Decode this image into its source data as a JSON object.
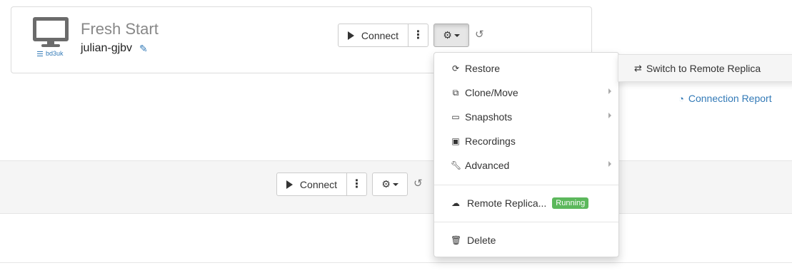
{
  "machine": {
    "title": "Fresh Start",
    "name": "julian-gjbv",
    "host_tag": "bd3uk"
  },
  "toolbar": {
    "connect_label": "Connect"
  },
  "row2": {
    "connect_label": "Connect"
  },
  "menu": {
    "items": [
      {
        "label": "Restore",
        "icon": "refresh-icon"
      },
      {
        "label": "Clone/Move",
        "icon": "copy-icon",
        "has_submenu": true
      },
      {
        "label": "Snapshots",
        "icon": "hdd-icon",
        "has_submenu": true
      },
      {
        "label": "Recordings",
        "icon": "film-icon"
      },
      {
        "label": "Advanced",
        "icon": "wrench-icon",
        "has_submenu": true
      }
    ],
    "remote_replica": {
      "label": "Remote Replica...",
      "status": "Running",
      "status_color": "#5cb85c"
    },
    "delete_label": "Delete"
  },
  "submenu": {
    "label": "Switch to Remote Replica"
  },
  "connection_report": {
    "label": "Connection Report"
  },
  "colors": {
    "link": "#337ab7",
    "danger": "#d9534f",
    "success": "#5cb85c"
  }
}
